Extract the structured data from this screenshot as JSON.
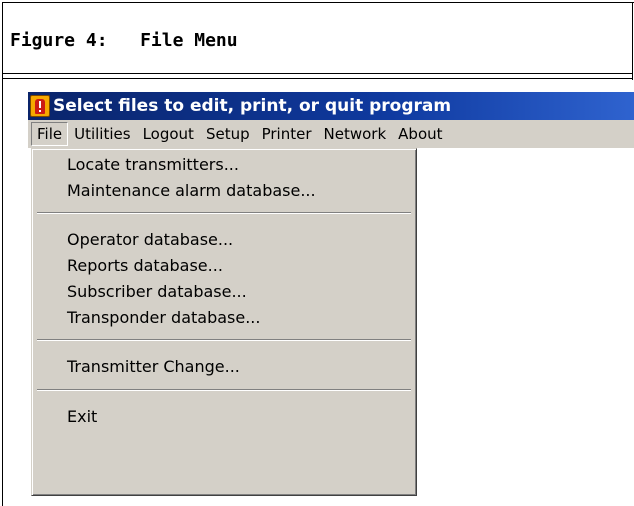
{
  "caption": {
    "label": "Figure 4:",
    "title": "File Menu"
  },
  "window": {
    "title": "Select files to edit, print, or quit program",
    "icon": "alarm-app-icon"
  },
  "menubar": {
    "items": [
      {
        "label": "File",
        "active": true
      },
      {
        "label": "Utilities"
      },
      {
        "label": "Logout"
      },
      {
        "label": "Setup"
      },
      {
        "label": "Printer"
      },
      {
        "label": "Network"
      },
      {
        "label": "About"
      }
    ]
  },
  "file_menu": {
    "items": [
      {
        "label": "Locate transmitters..."
      },
      {
        "label": "Maintenance alarm database..."
      },
      {
        "label": "Operator database..."
      },
      {
        "label": "Reports database..."
      },
      {
        "label": "Subscriber database..."
      },
      {
        "label": "Transponder database..."
      },
      {
        "label": "Transmitter Change..."
      },
      {
        "label": "Exit"
      }
    ]
  },
  "colors": {
    "titlebar": "#0a246a",
    "menu_bg": "#d4d0c8",
    "title_text": "#ffffff"
  }
}
